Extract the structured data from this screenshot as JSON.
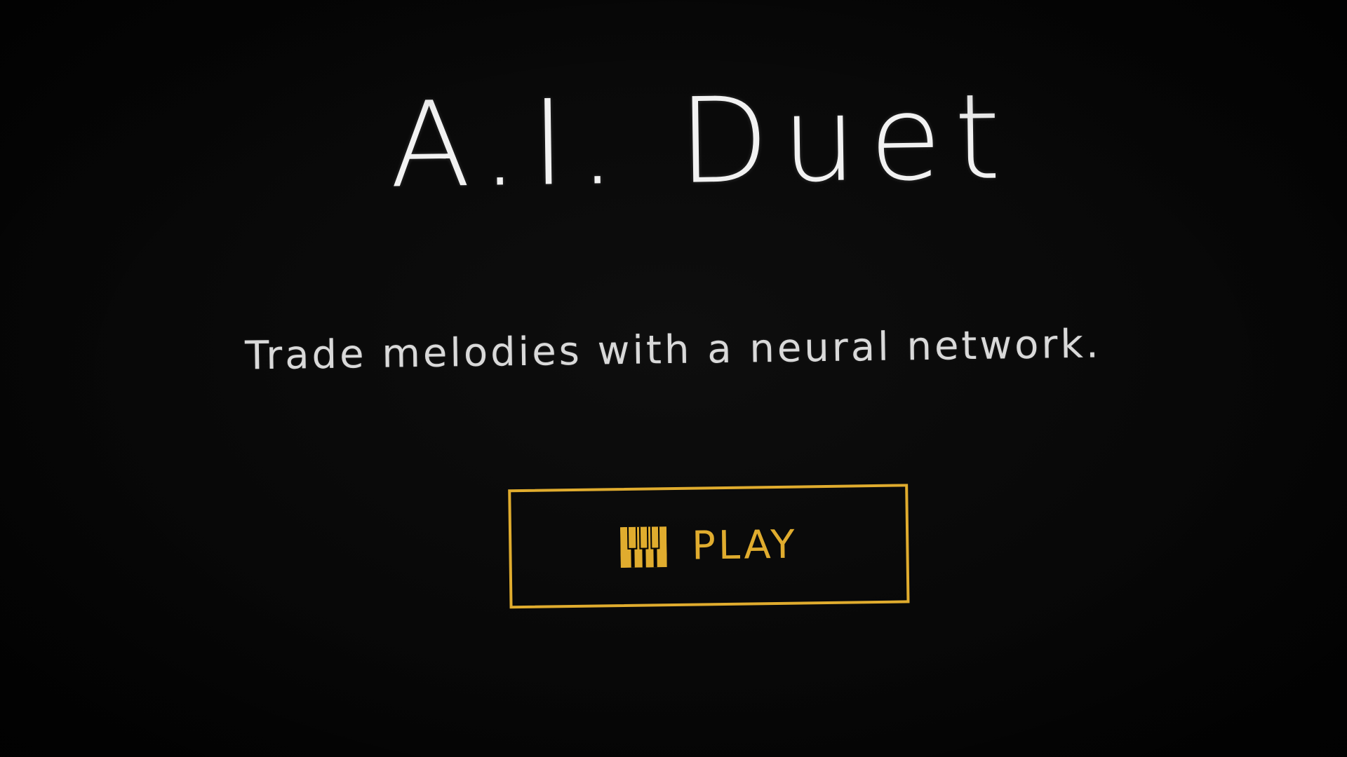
{
  "app": {
    "title": "A.I. Duet",
    "tagline": "Trade melodies with a neural network."
  },
  "play_button": {
    "label": "PLAY",
    "icon": "piano-keys-icon"
  },
  "colors": {
    "background": "#050505",
    "title_text": "#f2f2f2",
    "tagline_text": "#d9d9d9",
    "accent": "#e0ac2e"
  }
}
